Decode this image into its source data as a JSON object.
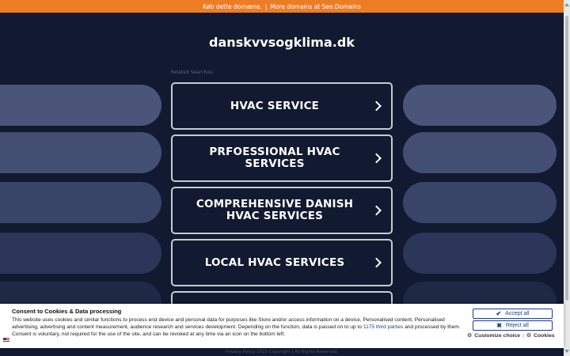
{
  "topbar": {
    "buy_link": "Køb dette domæne.",
    "separator": "|",
    "more_link": "More domains at Seo.Domains",
    "color": "#ed7d24"
  },
  "header": {
    "domain": "danskvvsogklima.dk"
  },
  "related": {
    "label": "Related Searches:",
    "items": [
      {
        "label": "HVAC SERVICE",
        "icon": "chevron-right-icon"
      },
      {
        "label": "PRFOESSIONAL HVAC SERVICES",
        "icon": "chevron-right-icon"
      },
      {
        "label": "COMPREHENSIVE DANISH HVAC SERVICES",
        "icon": "chevron-right-icon"
      },
      {
        "label": "LOCAL HVAC SERVICES",
        "icon": "chevron-right-icon"
      }
    ]
  },
  "footer": {
    "text": "Privacy Policy  2025 Copyright | All Rights Reserved."
  },
  "consent": {
    "heading": "Consent to Cookies & Data processing",
    "body_before": "This website uses cookies and similar functions to process end device and personal data for purposes like Store and/or access information on a device, Personalised content, Personalised advertising, advertising and content measurement, audience research and services development. Depending on the function, data is passed on to up to ",
    "third_parties_link": "1175 third parties",
    "body_after": " and processed by them. Consent is voluntary, not required for the use of the site, and can be revoked at any time via an icon on the bottom left.",
    "accept_all": "Accept all",
    "reject_all": "Reject all",
    "customize": "Customize choice",
    "link_separator": "|",
    "cookies": "Cookies",
    "accent": "#1f3c8f"
  }
}
